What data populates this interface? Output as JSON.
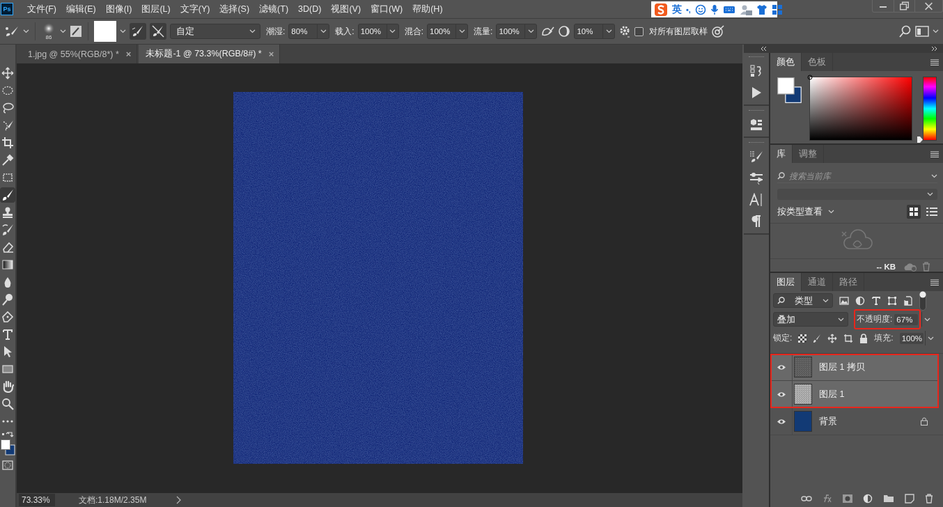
{
  "app": {
    "logo": "Ps"
  },
  "menu": [
    "文件(F)",
    "编辑(E)",
    "图像(I)",
    "图层(L)",
    "文字(Y)",
    "选择(S)",
    "滤镜(T)",
    "3D(D)",
    "视图(V)",
    "窗口(W)",
    "帮助(H)"
  ],
  "ime_bar": {
    "mode": "英",
    "punct": "•,"
  },
  "options": {
    "brush_size": "86",
    "preset": "自定",
    "fields": [
      {
        "label": "潮湿:",
        "value": "80%"
      },
      {
        "label": "载入:",
        "value": "100%"
      },
      {
        "label": "混合:",
        "value": "100%"
      },
      {
        "label": "流量:",
        "value": "100%"
      }
    ],
    "smoothing": "10%",
    "sample_all": {
      "label": "对所有图层取样",
      "checked": false
    }
  },
  "tabs": [
    {
      "label": "1.jpg @ 55%(RGB/8*) *",
      "close": "×",
      "selected": false
    },
    {
      "label": "未标题-1 @ 73.3%(RGB/8#) *",
      "close": "×",
      "selected": true
    }
  ],
  "status_bar": {
    "zoom": "73.33%",
    "doc_info": "文档:1.18M/2.35M"
  },
  "color_panel": {
    "tabs": [
      {
        "label": "颜色",
        "selected": true
      },
      {
        "label": "色板",
        "selected": false
      }
    ],
    "hue": {
      "level": 0
    }
  },
  "library_panel": {
    "tabs": [
      {
        "label": "库",
        "selected": true
      },
      {
        "label": "调整",
        "selected": false
      }
    ],
    "search_placeholder": "搜索当前库",
    "view_by": "按类型查看",
    "size": "-- KB"
  },
  "layers_panel": {
    "tabs": [
      {
        "label": "图层",
        "selected": true
      },
      {
        "label": "通道",
        "selected": false
      },
      {
        "label": "路径",
        "selected": false
      }
    ],
    "filter": "类型",
    "blend_mode": "叠加",
    "opacity_label": "不透明度:",
    "opacity": "67%",
    "opacity_highlighted": true,
    "lock_label": "锁定:",
    "fill_label": "填充:",
    "fill": "100%",
    "layers": [
      {
        "name": "图层 1 拷贝",
        "visible": true,
        "selected": true,
        "locked": false,
        "highlighted": true,
        "kind": "dark"
      },
      {
        "name": "图层 1",
        "visible": true,
        "selected": true,
        "locked": false,
        "highlighted": true,
        "kind": "light"
      },
      {
        "name": "背景",
        "visible": true,
        "selected": false,
        "locked": true,
        "highlighted": false,
        "kind": "solid"
      }
    ]
  }
}
